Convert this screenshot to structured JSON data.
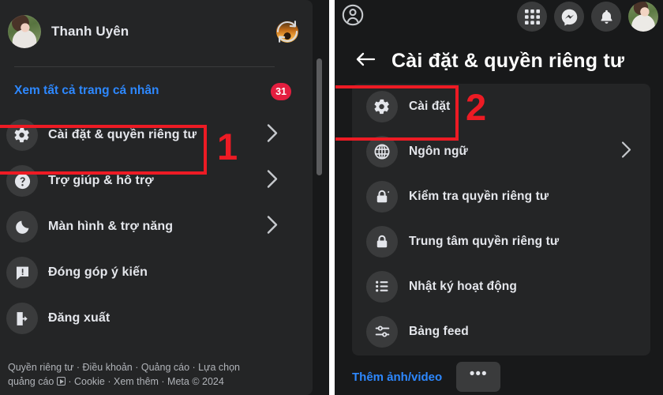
{
  "colors": {
    "page_bg": "#18191a",
    "card_bg": "#242526",
    "icon_circle": "#3a3b3c",
    "text_primary": "#e4e6eb",
    "text_secondary": "#b0b3b8",
    "link_blue": "#2d88ff",
    "badge_red": "#e41e3f",
    "annotation_red": "#ed1b24",
    "divider_white": "#ffffff"
  },
  "left_panel": {
    "profile": {
      "name": "Thanh Uyên",
      "avatar_icon": "user-avatar",
      "switcher_icon": "profile-switch-icon"
    },
    "see_all_profiles": "Xem tất cả trang cá nhân",
    "badge_count": "31",
    "menu_items": [
      {
        "label": "Cài đặt & quyền riêng tư",
        "icon": "gear-icon",
        "chevron": true,
        "highlighted": true
      },
      {
        "label": "Trợ giúp & hỗ trợ",
        "icon": "question-circle-icon",
        "chevron": true,
        "highlighted": false
      },
      {
        "label": "Màn hình & trợ năng",
        "icon": "moon-icon",
        "chevron": true,
        "highlighted": false
      },
      {
        "label": "Đóng góp ý kiến",
        "icon": "feedback-icon",
        "chevron": false,
        "highlighted": false
      },
      {
        "label": "Đăng xuất",
        "icon": "logout-icon",
        "chevron": false,
        "highlighted": false
      }
    ],
    "footer_line_1": "Quyền riêng tư · Điều khoản · Quảng cáo · Lựa chọn",
    "footer_line_2_before": "quảng cáo ",
    "footer_line_2_after": " · Cookie · Xem thêm · Meta © 2024",
    "scrollbar": "vertical-scrollbar"
  },
  "right_panel": {
    "topbar": {
      "friends_icon": "friends-circle-icon",
      "grid_icon": "app-grid-icon",
      "messenger_icon": "messenger-icon",
      "notifications_icon": "bell-icon",
      "avatar_icon": "user-avatar"
    },
    "header": {
      "back_icon": "back-arrow-icon",
      "title": "Cài đặt & quyền riêng tư"
    },
    "menu_items": [
      {
        "label": "Cài đặt",
        "icon": "gear-icon",
        "chevron": false,
        "highlighted": true
      },
      {
        "label": "Ngôn ngữ",
        "icon": "globe-icon",
        "chevron": true,
        "highlighted": false
      },
      {
        "label": "Kiểm tra quyền riêng tư",
        "icon": "lock-check-icon",
        "chevron": false,
        "highlighted": false
      },
      {
        "label": "Trung tâm quyền riêng tư",
        "icon": "lock-icon",
        "chevron": false,
        "highlighted": false
      },
      {
        "label": "Nhật ký hoạt động",
        "icon": "list-icon",
        "chevron": false,
        "highlighted": false
      },
      {
        "label": "Bảng feed",
        "icon": "sliders-icon",
        "chevron": false,
        "highlighted": false
      }
    ],
    "footer": {
      "add_media_label": "Thêm ảnh/video",
      "more_label": "•••",
      "more_icon": "ellipsis-icon"
    }
  },
  "annotations": [
    {
      "number": "1",
      "target": "Cài đặt & quyền riêng tư"
    },
    {
      "number": "2",
      "target": "Cài đặt"
    }
  ]
}
